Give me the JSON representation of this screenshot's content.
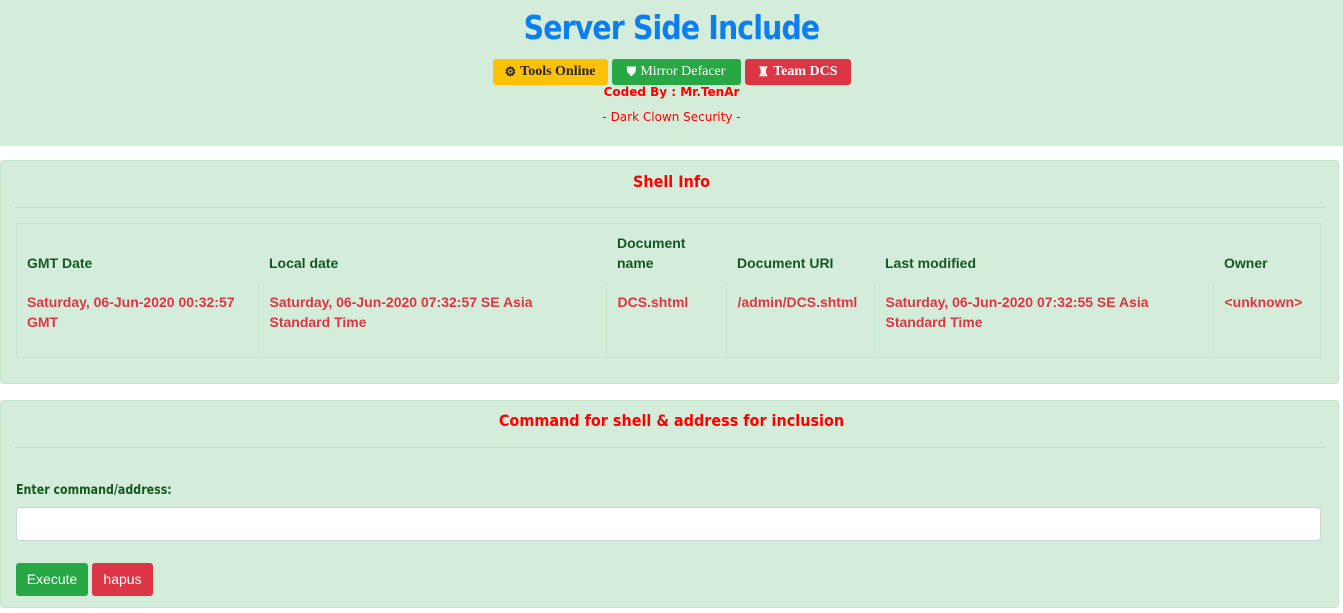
{
  "header": {
    "title": "Server Side Include",
    "buttons": [
      {
        "icon": "gear-icon",
        "glyph": "⚙",
        "label": "Tools Online",
        "color": "#ffc107"
      },
      {
        "icon": "shield-icon",
        "glyph": "⛊",
        "label": "Mirror Defacer",
        "color": "#28a745"
      },
      {
        "icon": "team-icon",
        "glyph": "♜",
        "label": "Team DCS",
        "color": "#dc3545"
      }
    ],
    "coded_by": "Coded By : Mr.TenAr",
    "team": "- Dark Clown Security -"
  },
  "shell_info": {
    "title": "Shell Info",
    "columns": [
      "GMT Date",
      "Local date",
      "Document name",
      "Document URI",
      "Last modified",
      "Owner"
    ],
    "row": [
      "Saturday, 06-Jun-2020 00:32:57 GMT",
      "Saturday, 06-Jun-2020 07:32:57 SE Asia Standard Time",
      "DCS.shtml",
      "/admin/DCS.shtml",
      "Saturday, 06-Jun-2020 07:32:55 SE Asia Standard Time",
      "<unknown>"
    ]
  },
  "command": {
    "title": "Command for shell & address for inclusion",
    "label": "Enter command/address:",
    "input_value": "",
    "execute_label": "Execute",
    "delete_label": "hapus"
  },
  "colors": {
    "background": "#d4edda",
    "title": "#0d7ef0",
    "accent_red": "#ff0000",
    "value_red": "#dc3545",
    "heading_green": "#155724"
  }
}
